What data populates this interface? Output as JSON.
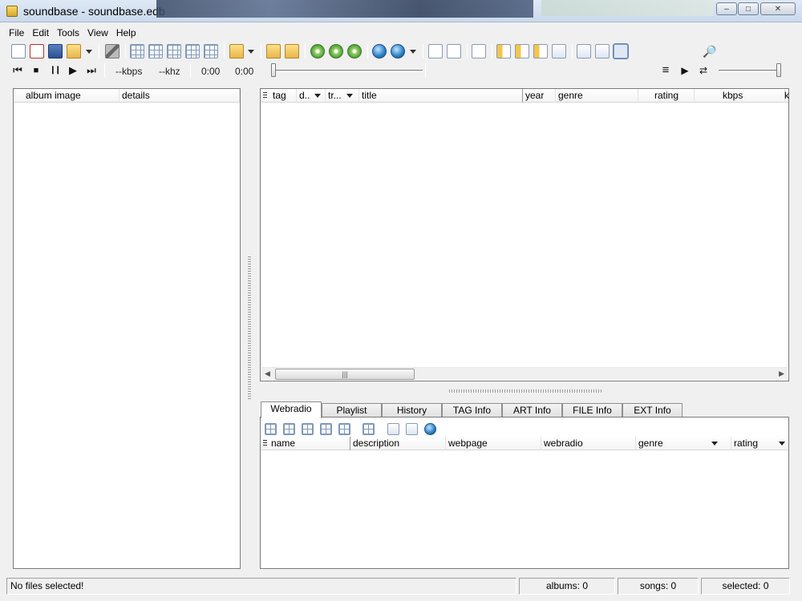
{
  "window": {
    "title": "soundbase - soundbase.edb",
    "minimize": "–",
    "maximize": "□",
    "close": "✕"
  },
  "menu": [
    "File",
    "Edit",
    "Tools",
    "View",
    "Help"
  ],
  "player": {
    "bitrate": "--kbps",
    "samplerate": "--khz",
    "elapsed": "0:00",
    "total": "0:00",
    "prev": "⏮",
    "stop": "■",
    "pause": "❙❙",
    "play": "▶",
    "next": "⏭",
    "playlist_icon": "≡",
    "queue_icon": "▶",
    "repeat_icon": "⇄"
  },
  "left_panel": {
    "columns": [
      "album image",
      "details"
    ]
  },
  "tracks_panel": {
    "columns": [
      "tag",
      "d..",
      "tr...",
      "title",
      "year",
      "genre",
      "rating",
      "kbps",
      "k"
    ],
    "scroll_grip": "|||",
    "scroll_left": "◀",
    "scroll_right": "▶"
  },
  "tabs": [
    "Webradio",
    "Playlist",
    "History",
    "TAG Info",
    "ART Info",
    "FILE Info",
    "EXT Info"
  ],
  "webradio": {
    "columns": [
      "name",
      "description",
      "webpage",
      "webradio",
      "genre",
      "rating"
    ]
  },
  "status": {
    "message": "No files selected!",
    "albums": "albums: 0",
    "songs": "songs: 0",
    "selected": "selected: 0"
  }
}
